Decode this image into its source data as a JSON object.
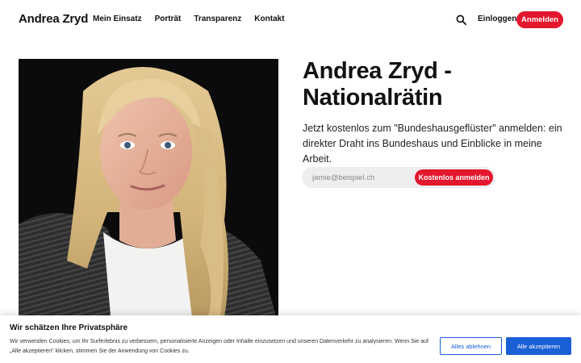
{
  "header": {
    "brand": "Andrea Zryd",
    "nav": [
      "Mein Einsatz",
      "Porträt",
      "Transparenz",
      "Kontakt"
    ],
    "search_icon": "search-icon",
    "login_label": "Einloggen",
    "signup_label": "Anmelden"
  },
  "hero": {
    "title": "Andrea Zryd - Nationalrätin",
    "subtitle": "Jetzt kostenlos zum \"Bundeshausgeflüster\" anmelden: ein direkter Draht ins Bundeshaus und Einblicke in meine Arbeit.",
    "email_placeholder": "jamie@beispiel.ch",
    "submit_label": "Kostenlos anmelden"
  },
  "cookie": {
    "title": "Wir schätzen Ihre Privatsphäre",
    "text": "Wir verwenden Cookies, um Ihr Surferlebnis zu verbessern, personalisierte Anzeigen oder Inhalte einzusetzen und unseren Datenverkehr zu analysieren. Wenn Sie auf „Alle akzeptieren\" klicken, stimmen Sie der Anwendung von Cookies zu.",
    "reject_label": "Alles ablehnen",
    "accept_label": "Alle akzeptieren"
  },
  "colors": {
    "accent_red": "#e3172d",
    "cookie_blue": "#1a5fd6"
  }
}
